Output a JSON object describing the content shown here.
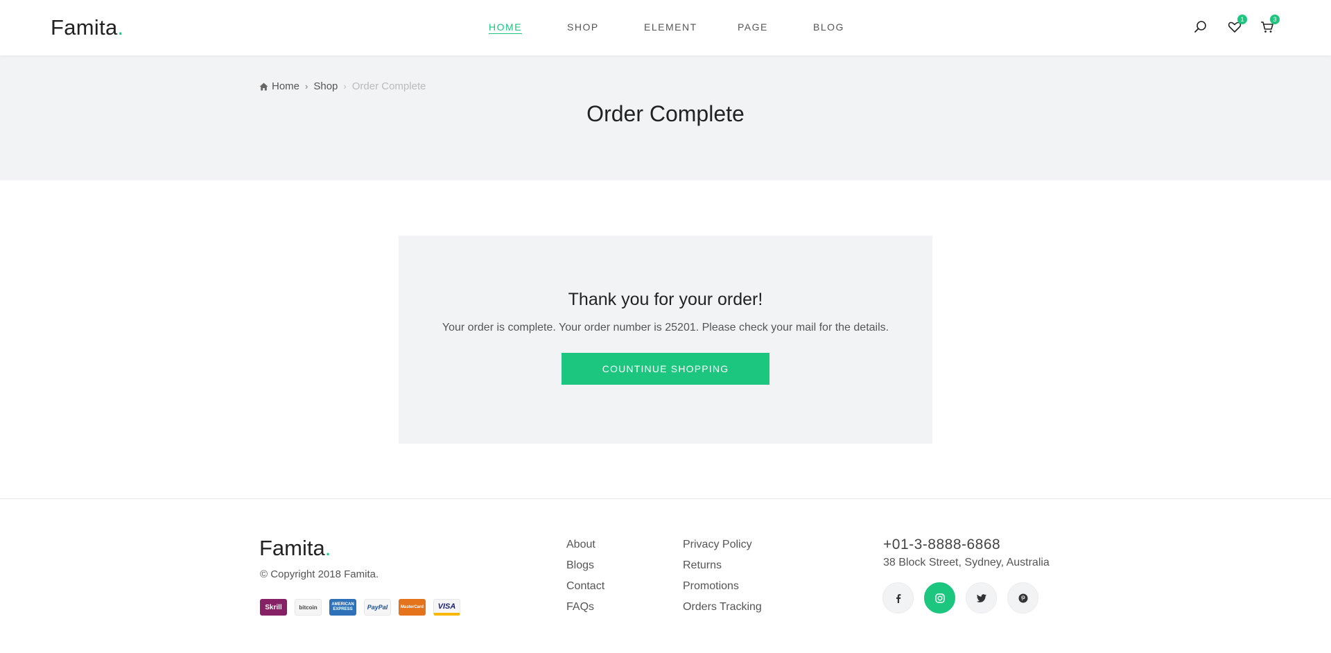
{
  "header": {
    "logo_text": "Famita",
    "logo_dot": ".",
    "nav": [
      {
        "label": "HOME",
        "active": true
      },
      {
        "label": "SHOP",
        "active": false
      },
      {
        "label": "ELEMENT",
        "active": false
      },
      {
        "label": "PAGE",
        "active": false
      },
      {
        "label": "BLOG",
        "active": false
      }
    ],
    "icons": {
      "search": "search-icon",
      "wishlist": "heart-icon",
      "cart": "cart-icon"
    },
    "wishlist_count": "1",
    "cart_count": "3"
  },
  "title_band": {
    "breadcrumb": [
      {
        "label": "Home",
        "icon": "home-icon"
      },
      {
        "label": "Shop"
      },
      {
        "label": "Order Complete",
        "current": true
      }
    ],
    "title": "Order Complete"
  },
  "order": {
    "heading": "Thank you for your order!",
    "message": "Your order is complete. Your order number is 25201. Please check your mail for the details.",
    "button_label": "COUNTINUE SHOPPING"
  },
  "footer": {
    "logo_text": "Famita",
    "logo_dot": ".",
    "copyright": "© Copyright 2018 Famita.",
    "payments": [
      {
        "name": "Skrill",
        "label": "Skrill"
      },
      {
        "name": "bitcoin",
        "label": "bitcoin"
      },
      {
        "name": "American Express",
        "label": "AMERICAN EXPRESS"
      },
      {
        "name": "PayPal",
        "label": "PayPal"
      },
      {
        "name": "MasterCard",
        "label": "MasterCard"
      },
      {
        "name": "VISA",
        "label": "VISA"
      }
    ],
    "links_col1": [
      "About",
      "Blogs",
      "Contact",
      "FAQs"
    ],
    "links_col2": [
      "Privacy Policy",
      "Returns",
      "Promotions",
      "Orders Tracking"
    ],
    "phone": "+01-3-8888-6868",
    "address": "38 Block Street, Sydney, Australia",
    "socials": [
      {
        "name": "facebook-icon",
        "active": false
      },
      {
        "name": "instagram-icon",
        "active": true
      },
      {
        "name": "twitter-icon",
        "active": false
      },
      {
        "name": "pinterest-icon",
        "active": false
      }
    ]
  },
  "colors": {
    "accent": "#1dc67f",
    "band_bg": "#f2f3f5"
  }
}
